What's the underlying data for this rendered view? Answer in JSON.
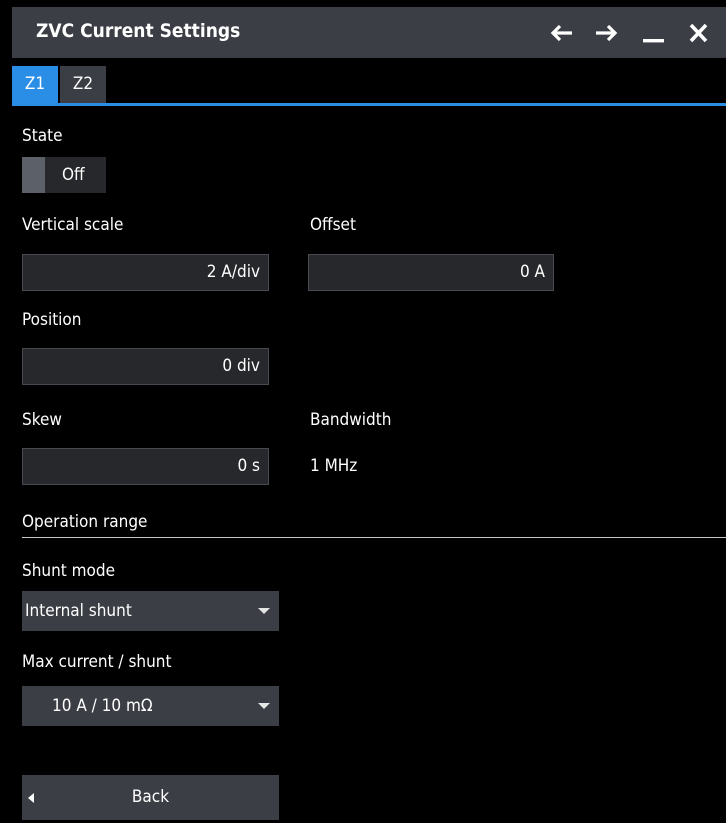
{
  "window": {
    "title": "ZVC Current Settings"
  },
  "titlebar_icons": [
    "arrow-left-icon",
    "arrow-right-icon",
    "minimize-icon",
    "close-icon"
  ],
  "tabs": [
    {
      "label": "Z1",
      "active": true
    },
    {
      "label": "Z2",
      "active": false
    }
  ],
  "state": {
    "label": "State",
    "value": "Off"
  },
  "vertical_scale": {
    "label": "Vertical scale",
    "value": "2 A/div"
  },
  "offset": {
    "label": "Offset",
    "value": "0 A"
  },
  "position": {
    "label": "Position",
    "value": "0 div"
  },
  "skew": {
    "label": "Skew",
    "value": "0 s"
  },
  "bandwidth": {
    "label": "Bandwidth",
    "value": "1 MHz"
  },
  "operation_range": {
    "heading": "Operation range"
  },
  "shunt_mode": {
    "label": "Shunt mode",
    "value": "Internal shunt"
  },
  "max_current": {
    "label": "Max current / shunt",
    "value": "10 A / 10 mΩ"
  },
  "back_button": {
    "label": "Back"
  },
  "colors": {
    "accent": "#2b8ee6",
    "panel": "#3b3e45",
    "field": "#26282b",
    "background": "#000000"
  }
}
